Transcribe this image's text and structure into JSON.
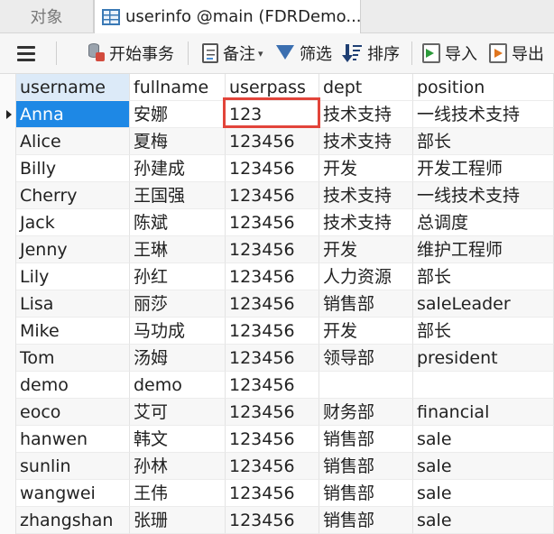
{
  "tabs": [
    {
      "label": "对象",
      "active": false
    },
    {
      "label": "userinfo @main (FDRDemo...",
      "active": true
    }
  ],
  "toolbar": {
    "begin_tx": "开始事务",
    "note": "备注",
    "filter": "筛选",
    "sort": "排序",
    "import": "导入",
    "export": "导出"
  },
  "table": {
    "columns": [
      "username",
      "fullname",
      "userpass",
      "dept",
      "position"
    ],
    "sorted_column": "username",
    "rows": [
      [
        "Anna",
        "安娜",
        "123",
        "技术支持",
        "一线技术支持"
      ],
      [
        "Alice",
        "夏梅",
        "123456",
        "技术支持",
        "部长"
      ],
      [
        "Billy",
        "孙建成",
        "123456",
        "开发",
        "开发工程师"
      ],
      [
        "Cherry",
        "王国强",
        "123456",
        "技术支持",
        "一线技术支持"
      ],
      [
        "Jack",
        "陈斌",
        "123456",
        "技术支持",
        "总调度"
      ],
      [
        "Jenny",
        "王琳",
        "123456",
        "开发",
        "维护工程师"
      ],
      [
        "Lily",
        "孙红",
        "123456",
        "人力资源",
        "部长"
      ],
      [
        "Lisa",
        "丽莎",
        "123456",
        "销售部",
        "saleLeader"
      ],
      [
        "Mike",
        "马功成",
        "123456",
        "开发",
        "部长"
      ],
      [
        "Tom",
        "汤姆",
        "123456",
        "领导部",
        "president"
      ],
      [
        "demo",
        "demo",
        "123456",
        "",
        ""
      ],
      [
        "eoco",
        "艾可",
        "123456",
        "财务部",
        "financial"
      ],
      [
        "hanwen",
        "韩文",
        "123456",
        "销售部",
        "sale"
      ],
      [
        "sunlin",
        "孙林",
        "123456",
        "销售部",
        "sale"
      ],
      [
        "wangwei",
        "王伟",
        "123456",
        "销售部",
        "sale"
      ],
      [
        "zhangshan",
        "张珊",
        "123456",
        "销售部",
        "sale"
      ]
    ]
  },
  "colors": {
    "selection": "#1e88e5",
    "highlight_box": "#e2443a"
  }
}
